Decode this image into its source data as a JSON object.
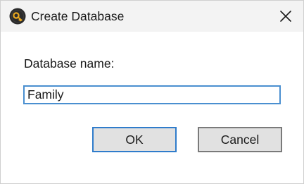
{
  "window": {
    "title": "Create Database"
  },
  "icons": {
    "app": "database-key-icon",
    "close": "close-icon"
  },
  "form": {
    "label": "Database name:",
    "name_value": "Family"
  },
  "buttons": {
    "ok_label": "OK",
    "cancel_label": "Cancel"
  },
  "colors": {
    "titlebar_bg": "#f3f3f3",
    "input_border": "#4a8fd0",
    "ok_border": "#2f7ccb",
    "button_bg": "#e1e1e1"
  }
}
